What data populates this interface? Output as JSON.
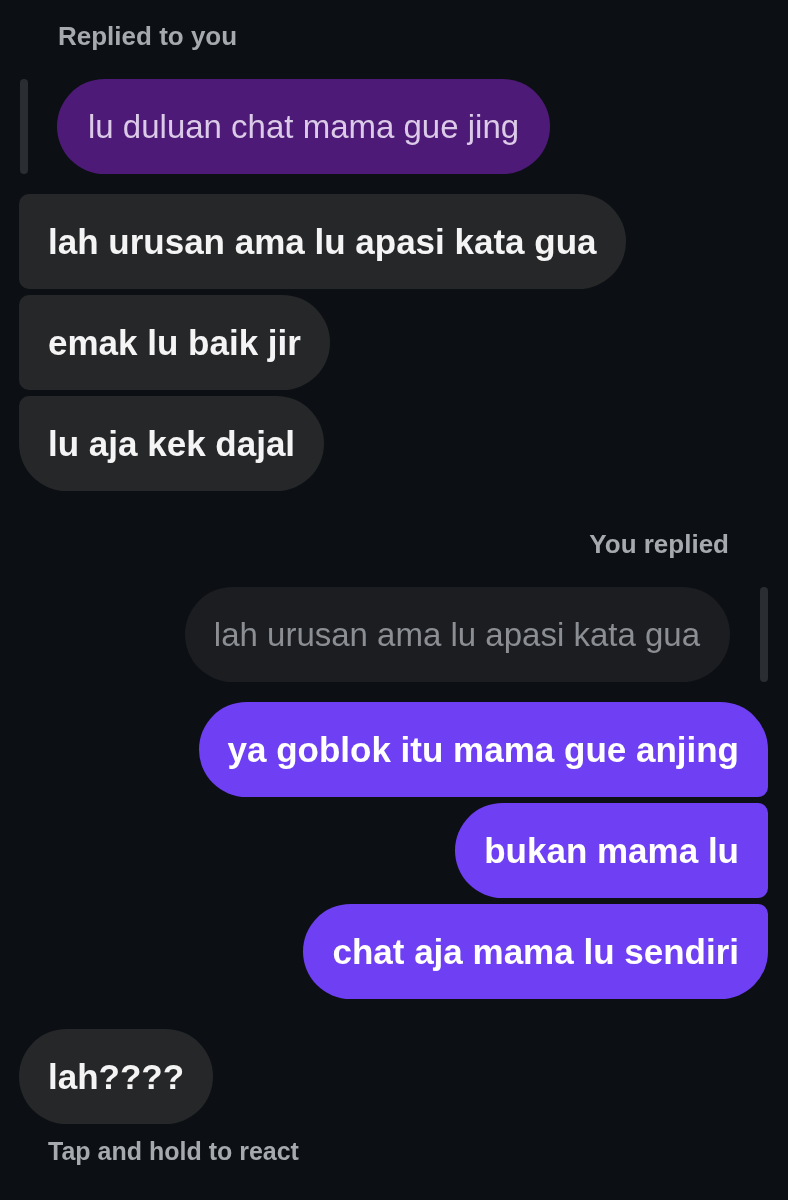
{
  "conversation": [
    {
      "kind": "label",
      "outgoing": false,
      "text": "Replied to you"
    },
    {
      "kind": "quote",
      "outgoing": false,
      "text": "lu duluan chat mama gue jing"
    },
    {
      "kind": "bubble",
      "outgoing": false,
      "text": "lah urusan ama lu apasi kata gua"
    },
    {
      "kind": "bubble",
      "outgoing": false,
      "text": "emak lu baik jir"
    },
    {
      "kind": "bubble",
      "outgoing": false,
      "text": "lu aja kek dajal"
    },
    {
      "kind": "label",
      "outgoing": true,
      "text": "You replied"
    },
    {
      "kind": "quote",
      "outgoing": true,
      "text": "lah urusan ama lu apasi kata gua"
    },
    {
      "kind": "bubble",
      "outgoing": true,
      "text": "ya goblok itu mama gue anjing"
    },
    {
      "kind": "bubble",
      "outgoing": true,
      "text": "bukan mama lu"
    },
    {
      "kind": "bubble",
      "outgoing": true,
      "text": "chat aja mama lu sendiri"
    },
    {
      "kind": "bubble",
      "outgoing": false,
      "text": "lah????"
    }
  ],
  "hint": "Tap and hold to react"
}
